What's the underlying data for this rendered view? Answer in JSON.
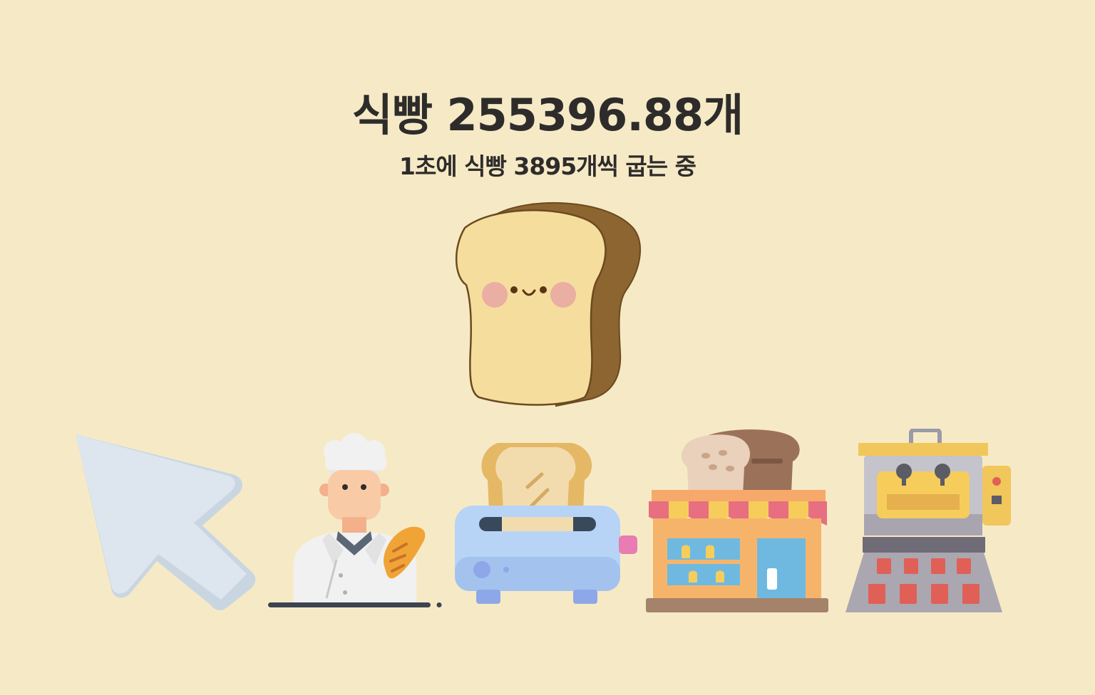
{
  "counter": {
    "label": "식빵",
    "amount": "255396.88",
    "unit": "개"
  },
  "rate": {
    "text": "1초에 식빵 3895개씩 굽는 중"
  },
  "main_bread": {
    "icon": "toast-bread-face-icon"
  },
  "upgrades": [
    {
      "icon": "cursor-arrow-icon"
    },
    {
      "icon": "baker-chef-icon"
    },
    {
      "icon": "toaster-icon"
    },
    {
      "icon": "bakery-shop-icon"
    },
    {
      "icon": "bread-factory-oven-icon"
    }
  ],
  "colors": {
    "background": "#f6eac6",
    "text": "#2e2c2b",
    "bread_crust": "#8c6530",
    "bread_face": "#f5dd9e"
  }
}
